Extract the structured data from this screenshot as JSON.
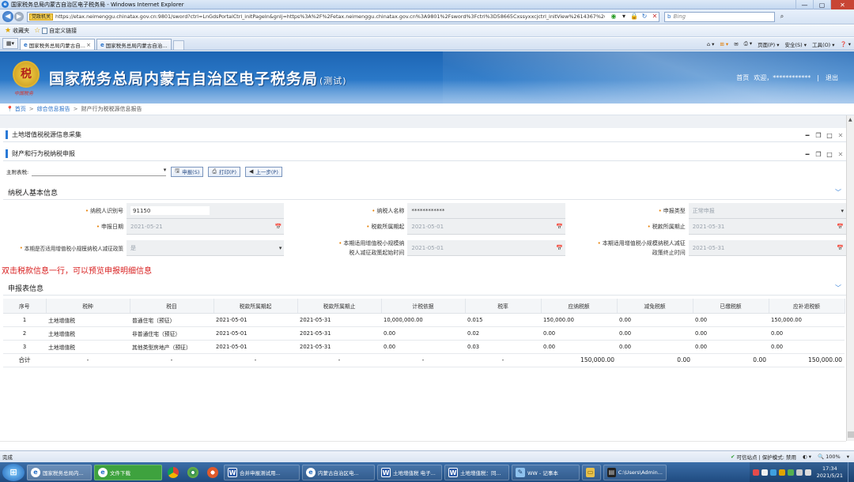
{
  "window": {
    "title": "国家税务总局内蒙古自治区电子税务局 - Windows Internet Explorer",
    "minimize": "—",
    "maximize": "▢",
    "close": "✕"
  },
  "addressbar": {
    "site_tag": "党政机关",
    "url": "https://etax.neimenggu.chinatax.gov.cn:9801/sword?ctrl=LnGdsPortalCtrl_initPageIn&gnlj=https%3A%2F%2Fetax.neimenggu.chinatax.gov.cn%3A9801%2Fsword%3Fctrl%3D58665Cxssyxxcjctrl_initView%2614367%26sDate%3D",
    "search_placeholder": "Bing"
  },
  "favorites": {
    "label": "收藏夹",
    "custom_link": "自定义链接"
  },
  "tabs": [
    {
      "label": "国家税务总局内蒙古自..."
    },
    {
      "label": "国家税务总局内蒙古自治..."
    }
  ],
  "commandbar": {
    "page": "页面(P) ▾",
    "safety": "安全(S) ▾",
    "tools": "工具(O) ▾",
    "help": "❓ ▾"
  },
  "banner": {
    "emblem_glyph": "税",
    "emblem_sub": "中国税务",
    "title": "国家税务总局内蒙古自治区电子税务局",
    "test_tag": "(测试)",
    "home_link": "首页",
    "welcome": "欢迎，************",
    "logout": "退出"
  },
  "breadcrumb": {
    "home": "首页",
    "level1": "综合信息报告",
    "current": "财产行为税税源信息报告"
  },
  "panels": {
    "land_vat": "土地增值税税源信息采集",
    "property_declare": "财产和行为税纳税申报"
  },
  "toolbar": {
    "main_tax_label": "主附表税:",
    "declare_btn": "申报(S)",
    "print_btn": "打印(P)",
    "prev_btn": "上一步(P)"
  },
  "basic_info": {
    "section_title": "纳税人基本信息",
    "taxpayer_id_label": "纳税人识别号",
    "taxpayer_id_value": "91150",
    "taxpayer_name_label": "纳税人名称",
    "taxpayer_name_value": "************",
    "declare_type_label": "申报类型",
    "declare_type_value": "正常申报",
    "declare_date_label": "申报日期",
    "declare_date_value": "2021-05-21",
    "period_start_label": "税款所属期起",
    "period_start_value": "2021-05-01",
    "period_end_label": "税款所属期止",
    "period_end_value": "2021-05-31",
    "small_scale_label": "本期是否适用增值税小规模纳税人减征政策",
    "small_scale_value": "是",
    "policy_start_label_1": "本期适用增值税小规模纳",
    "policy_start_label_2": "税人减征政策起始时间",
    "policy_start_value": "2021-05-01",
    "policy_end_label_1": "本期适用增值税小规模纳税人减征",
    "policy_end_label_2": "政策终止时间",
    "policy_end_value": "2021-05-31"
  },
  "hint": "双击税款信息一行，可以预览申报明细信息",
  "declare_table": {
    "section_title": "申报表信息",
    "headers": [
      "序号",
      "税种",
      "税目",
      "税款所属期起",
      "税款所属期止",
      "计税依据",
      "税率",
      "应纳税额",
      "减免税额",
      "已缴税额",
      "应补退税额"
    ],
    "rows": [
      [
        "1",
        "土地增值税",
        "普通住宅（预征）",
        "2021-05-01",
        "2021-05-31",
        "10,000,000.00",
        "0.015",
        "150,000.00",
        "0.00",
        "0.00",
        "150,000.00"
      ],
      [
        "2",
        "土地增值税",
        "非普通住宅（预征）",
        "2021-05-01",
        "2021-05-31",
        "0.00",
        "0.02",
        "0.00",
        "0.00",
        "0.00",
        "0.00"
      ],
      [
        "3",
        "土地增值税",
        "其他类型房地产（预征）",
        "2021-05-01",
        "2021-05-31",
        "0.00",
        "0.03",
        "0.00",
        "0.00",
        "0.00",
        "0.00"
      ]
    ],
    "total_row": [
      "合计",
      "-",
      "-",
      "-",
      "-",
      "-",
      "-",
      "150,000.00",
      "0.00",
      "0.00",
      "150,000.00"
    ]
  },
  "statusbar": {
    "left": "完成",
    "trusted": "可信站点 | 保护模式: 禁用",
    "zoom": "100%"
  },
  "taskbar": {
    "items": [
      {
        "label": "国家税务总局内..."
      },
      {
        "label": "文件下载"
      },
      {
        "label": "合并申报测试用..."
      },
      {
        "label": "内蒙古自治区电..."
      },
      {
        "label": "土地增值税 电子..."
      },
      {
        "label": "土地增值税：同..."
      },
      {
        "label": "WW - 记事本"
      },
      {
        "label": ""
      },
      {
        "label": "C:\\Users\\Admin..."
      }
    ],
    "time": "17:34",
    "date": "2021/5/21"
  }
}
